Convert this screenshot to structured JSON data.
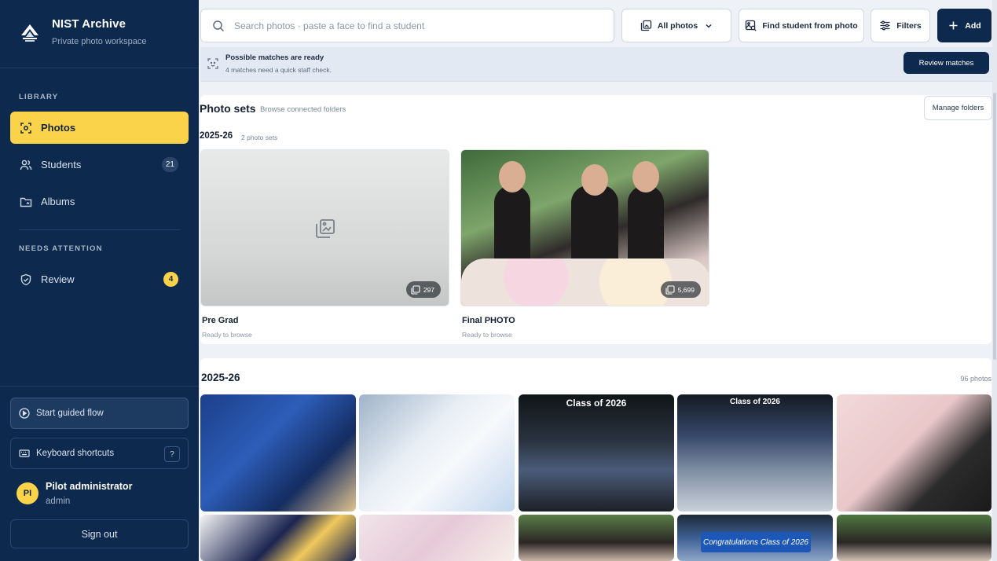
{
  "app": {
    "title": "NIST Archive",
    "subtitle": "Private photo workspace"
  },
  "sidebar": {
    "sections": {
      "library": "LIBRARY",
      "needs_attention": "NEEDS ATTENTION"
    },
    "items": [
      {
        "label": "Photos",
        "icon": "photos-icon",
        "active": true
      },
      {
        "label": "Students",
        "icon": "students-icon",
        "count": "21"
      },
      {
        "label": "Albums",
        "icon": "albums-icon"
      },
      {
        "label": "Review",
        "icon": "review-shield-icon",
        "count": "4"
      }
    ],
    "guided_flow": "Start guided flow",
    "shortcuts": {
      "label": "Keyboard shortcuts",
      "key": "?"
    },
    "user": {
      "initials": "PI",
      "name": "Pilot administrator",
      "role": "admin"
    },
    "sign_out": "Sign out"
  },
  "topbar": {
    "search_placeholder": "Search photos · paste a face to find a student",
    "filter_select": "All photos",
    "find_student": "Find student from photo",
    "filters": "Filters",
    "add": "Add"
  },
  "banner": {
    "title": "Possible matches are ready",
    "subtitle": "4 matches need a quick staff check.",
    "button": "Review matches"
  },
  "photo_sets": {
    "title": "Photo sets",
    "subtitle": "Browse connected folders",
    "manage": "Manage folders",
    "year": "2025-26",
    "year_count": "2 photo sets",
    "sets": [
      {
        "name": "Pre Grad",
        "status": "Ready to browse",
        "count": "297"
      },
      {
        "name": "Final PHOTO",
        "status": "Ready to browse",
        "count": "5,699"
      }
    ]
  },
  "gallery": {
    "title": "2025-26",
    "count": "96 photos",
    "captions": {
      "class_of": "Class of 2026",
      "congrats": "Congratulations Class of 2026"
    }
  },
  "colors": {
    "sidebar": "#0d2a4e",
    "accent": "#fad34a",
    "primary": "#0d2a4e"
  }
}
